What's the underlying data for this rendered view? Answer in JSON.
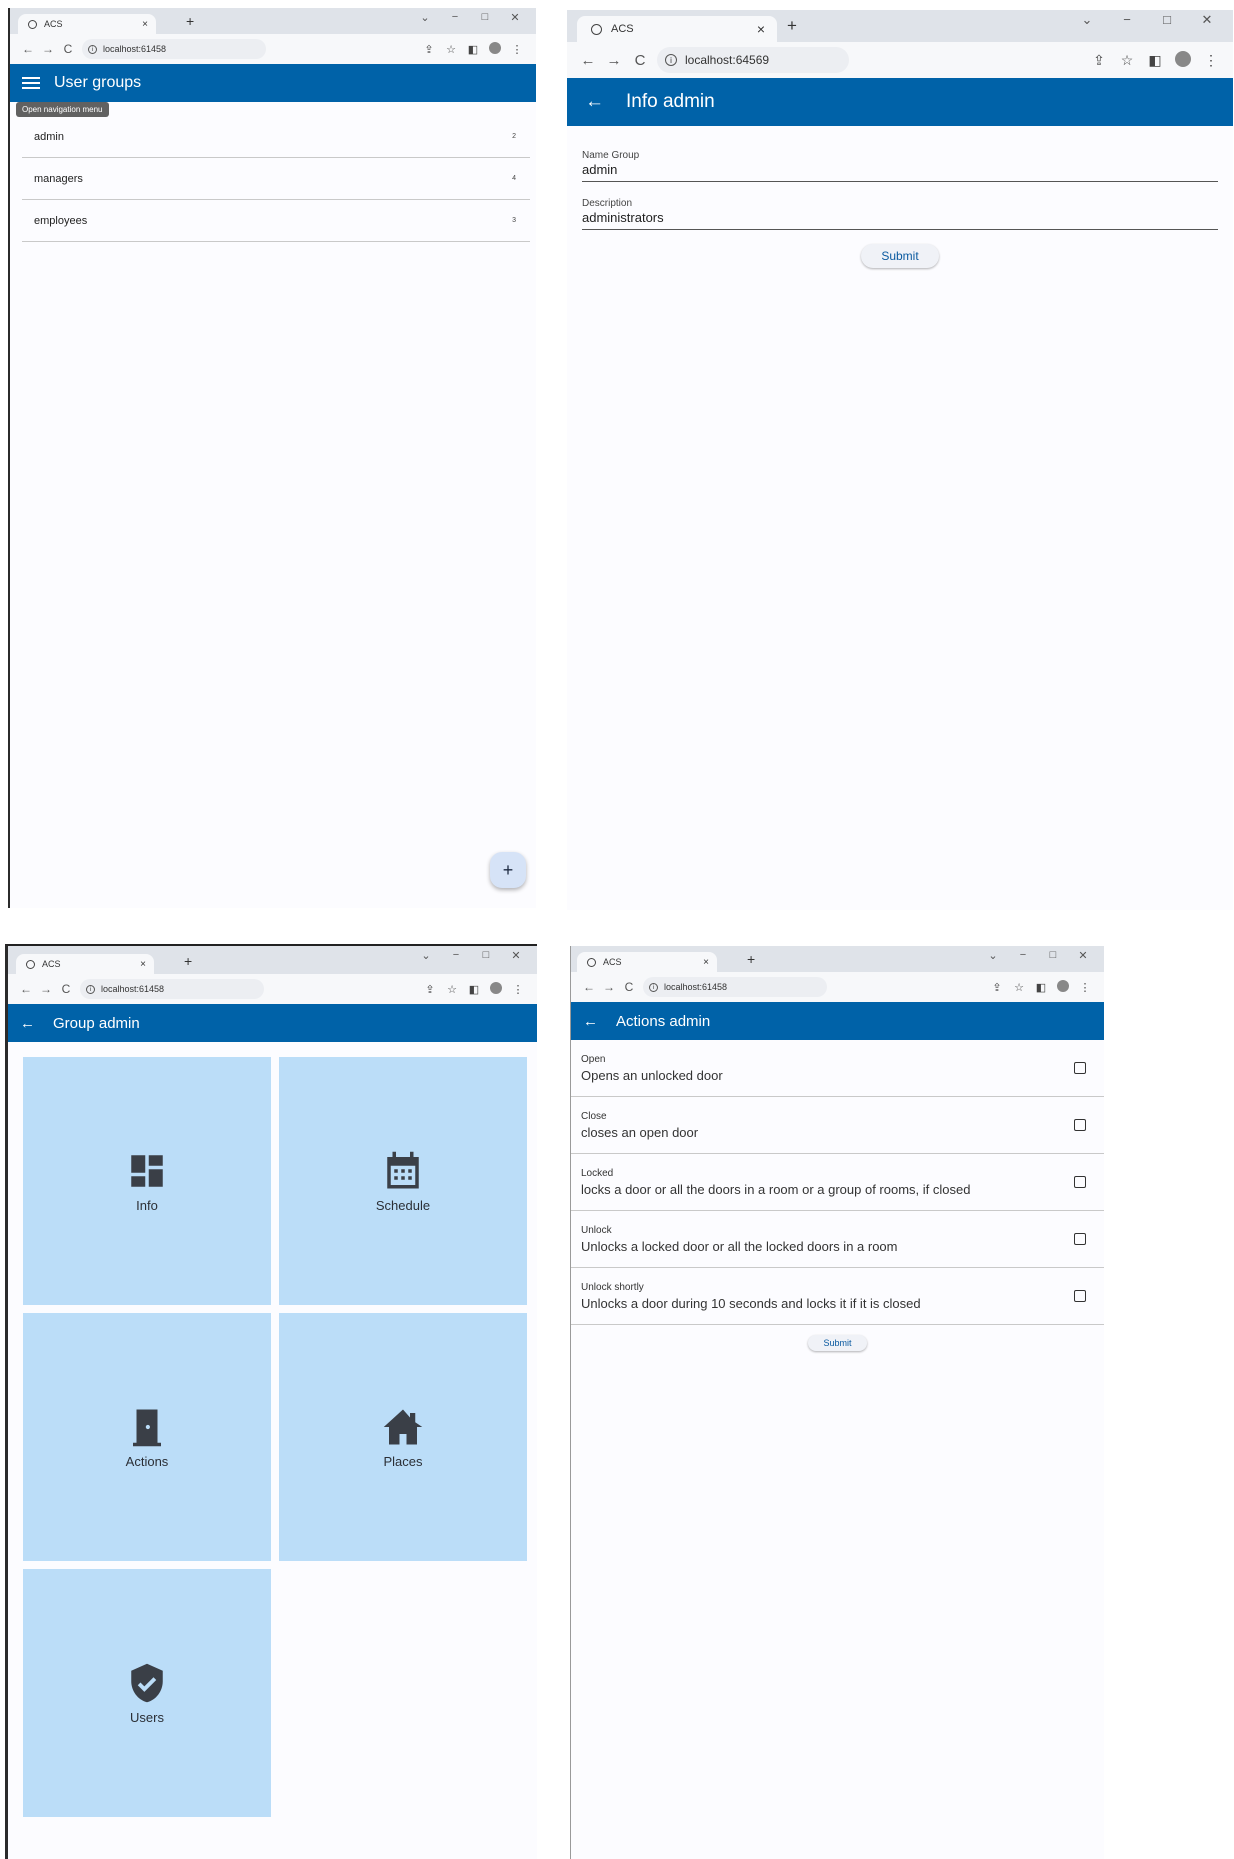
{
  "browser": {
    "tab_title": "ACS",
    "tab_close": "×",
    "new_tab": "+",
    "win_min": "−",
    "win_max": "□",
    "win_close": "✕",
    "win_chevron": "⌄",
    "back": "←",
    "forward": "→",
    "reload": "C",
    "menu_dots": "⋮",
    "share": "⇪",
    "star": "☆",
    "panel": "◧"
  },
  "win1": {
    "url": "localhost:61458",
    "title": "User groups",
    "tooltip": "Open navigation menu",
    "groups": [
      {
        "name": "admin",
        "count": "2"
      },
      {
        "name": "managers",
        "count": "4"
      },
      {
        "name": "employees",
        "count": "3"
      }
    ],
    "fab": "+"
  },
  "win2": {
    "url": "localhost:64569",
    "title": "Info admin",
    "fields": [
      {
        "label": "Name Group",
        "value": "admin"
      },
      {
        "label": "Description",
        "value": "administrators"
      }
    ],
    "submit": "Submit"
  },
  "win3": {
    "url": "localhost:61458",
    "title": "Group admin",
    "tiles": [
      {
        "label": "Info",
        "icon": "dashboard-icon"
      },
      {
        "label": "Schedule",
        "icon": "calendar-icon"
      },
      {
        "label": "Actions",
        "icon": "door-icon"
      },
      {
        "label": "Places",
        "icon": "house-icon"
      },
      {
        "label": "Users",
        "icon": "shield-check-icon"
      }
    ]
  },
  "win4": {
    "url": "localhost:61458",
    "title": "Actions admin",
    "actions": [
      {
        "label": "Open",
        "description": "Opens an unlocked door"
      },
      {
        "label": "Close",
        "description": "closes an open door"
      },
      {
        "label": "Locked",
        "description": "locks a door or all the doors in a room or a group of rooms, if closed"
      },
      {
        "label": "Unlock",
        "description": "Unlocks a locked door or all the locked doors in a room"
      },
      {
        "label": "Unlock shortly",
        "description": "Unlocks a door during 10 seconds and locks it if it is closed"
      }
    ],
    "submit": "Submit"
  },
  "colors": {
    "appbar": "#0062a8",
    "tile": "#bbddf8",
    "icon": "#3a3f47"
  }
}
